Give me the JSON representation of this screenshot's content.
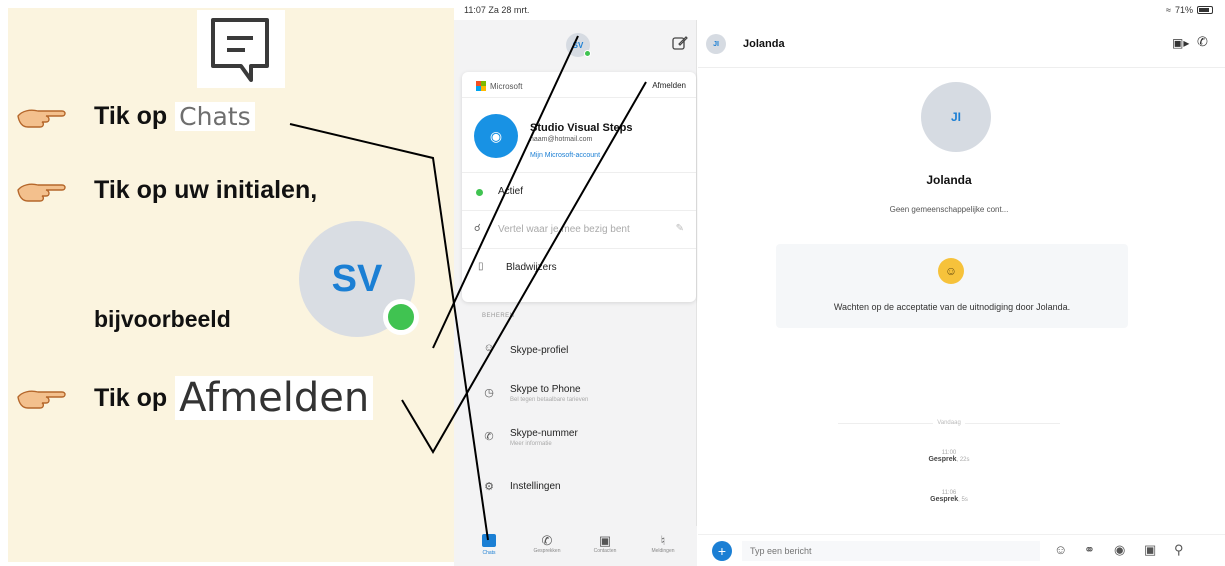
{
  "instructions": {
    "steps": [
      {
        "prefix": "Tik op",
        "chip": "Chats"
      },
      {
        "prefix": "Tik op uw initialen,"
      },
      {
        "prefix": "bijvoorbeeld"
      },
      {
        "prefix": "Tik op",
        "chip": "Afmelden"
      }
    ],
    "avatar_initials": "SV"
  },
  "status_bar": {
    "time": "11:07  Za 28 mrt.",
    "battery": "71%"
  },
  "sidebar": {
    "avatar_initials": "SV",
    "account_card": {
      "provider": "Microsoft",
      "signout_label": "Afmelden",
      "name": "Studio Visual Steps",
      "email": "naam@hotmail.com",
      "account_link": "Mijn Microsoft-account",
      "status": "Actief",
      "mood_placeholder": "Vertel waar je mee bezig bent"
    },
    "items": [
      {
        "label": "Bladwijzers",
        "icon": "bookmark-icon"
      },
      {
        "label": "Skype-profiel",
        "icon": "person-icon"
      },
      {
        "label": "Skype to Phone",
        "sub": "Bel tegen betaalbare tarieven",
        "icon": "phone-credit-icon"
      },
      {
        "label": "Skype-nummer",
        "sub": "Meer informatie",
        "icon": "phone-number-icon"
      },
      {
        "label": "Instellingen",
        "icon": "gear-icon"
      }
    ],
    "section_header": "BEHEREN",
    "tabs": [
      {
        "label": "Chats",
        "icon": "chat-icon"
      },
      {
        "label": "Gesprekken",
        "icon": "phone-icon"
      },
      {
        "label": "Contacten",
        "icon": "contacts-icon"
      },
      {
        "label": "Meldingen",
        "icon": "bell-icon"
      }
    ]
  },
  "chat": {
    "contact_initials": "JI",
    "contact_name": "Jolanda",
    "mutual_contacts": "Geen gemeenschappelijke cont...",
    "invite_message": "Wachten op de acceptatie van de uitnodiging door Jolanda.",
    "divider": "Vandaag",
    "calls": [
      {
        "time": "11:00",
        "label": "Gesprek",
        "duration": "22s"
      },
      {
        "time": "11:06",
        "label": "Gesprek",
        "duration": "5s"
      }
    ],
    "composer_placeholder": "Typ een bericht"
  }
}
